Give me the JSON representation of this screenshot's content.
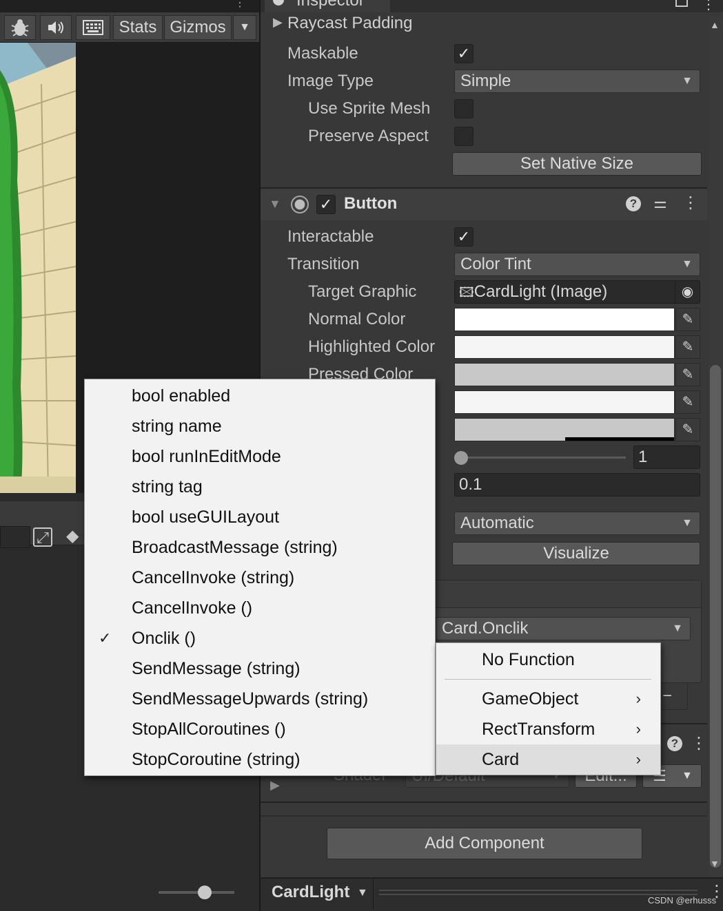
{
  "game_toolbar": {
    "stats_label": "Stats",
    "gizmos_label": "Gizmos",
    "icons": [
      "bug-icon",
      "audio-icon",
      "keyboard-grid-icon"
    ]
  },
  "inspector": {
    "tab_title": "Inspector",
    "image_component": {
      "raycast_padding_label": "Raycast Padding",
      "maskable_label": "Maskable",
      "maskable_checked": true,
      "image_type_label": "Image Type",
      "image_type_value": "Simple",
      "use_sprite_mesh_label": "Use Sprite Mesh",
      "preserve_aspect_label": "Preserve Aspect",
      "set_native_size_label": "Set Native Size"
    },
    "button_component": {
      "title": "Button",
      "enabled": true,
      "interactable_label": "Interactable",
      "interactable_checked": true,
      "transition_label": "Transition",
      "transition_value": "Color Tint",
      "target_graphic_label": "Target Graphic",
      "target_graphic_value": "CardLight (Image)",
      "normal_color_label": "Normal Color",
      "highlighted_color_label": "Highlighted Color",
      "pressed_color_label": "Pressed Color",
      "color_multiplier_value": "1",
      "fade_duration_value": "0.1",
      "navigation_value": "Automatic",
      "visualize_label": "Visualize",
      "onclick_function": "Card.Onclik",
      "colors": {
        "normal": "#ffffff",
        "highlighted": "#f5f5f5",
        "pressed": "#c8c8c8",
        "selected": "#f5f5f5",
        "disabled": "#c8c8c8"
      }
    },
    "material": {
      "shader_label": "Shader",
      "shader_value": "UI/Default",
      "edit_label": "Edit..."
    },
    "add_component_label": "Add Component",
    "footer_object": "CardLight"
  },
  "method_menu": {
    "items": [
      {
        "label": "bool enabled",
        "checked": false
      },
      {
        "label": "string name",
        "checked": false
      },
      {
        "label": "bool runInEditMode",
        "checked": false
      },
      {
        "label": "string tag",
        "checked": false
      },
      {
        "label": "bool useGUILayout",
        "checked": false
      },
      {
        "label": "BroadcastMessage (string)",
        "checked": false
      },
      {
        "label": "CancelInvoke (string)",
        "checked": false
      },
      {
        "label": "CancelInvoke ()",
        "checked": false
      },
      {
        "label": "Onclik ()",
        "checked": true
      },
      {
        "label": "SendMessage (string)",
        "checked": false
      },
      {
        "label": "SendMessageUpwards (string)",
        "checked": false
      },
      {
        "label": "StopAllCoroutines ()",
        "checked": false
      },
      {
        "label": "StopCoroutine (string)",
        "checked": false
      }
    ],
    "check_glyph": "✓"
  },
  "component_menu": {
    "no_function": "No Function",
    "items": [
      {
        "label": "GameObject",
        "has_submenu": true,
        "highlighted": false
      },
      {
        "label": "RectTransform",
        "has_submenu": true,
        "highlighted": false
      },
      {
        "label": "Card",
        "has_submenu": true,
        "highlighted": true
      }
    ]
  },
  "watermark": "CSDN @erhusss"
}
